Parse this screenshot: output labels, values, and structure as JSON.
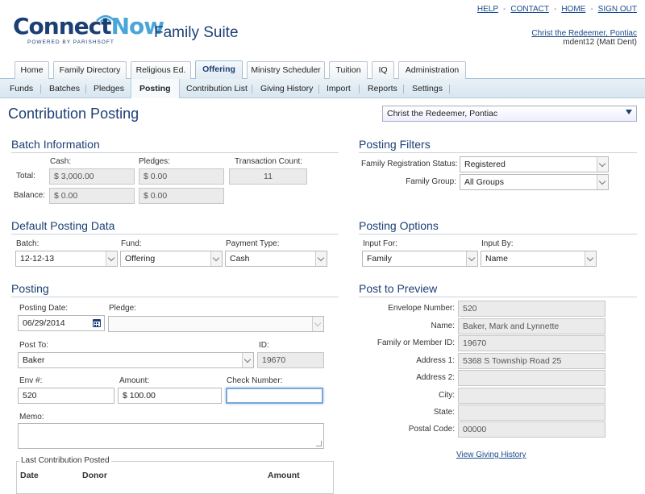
{
  "header": {
    "logo_connect": "Connect",
    "logo_now": "Now",
    "logo_sub": "POWERED BY PARISHSOFT",
    "suite_title": "Family Suite",
    "links": [
      "HELP",
      "CONTACT",
      "HOME",
      "SIGN OUT"
    ],
    "parish_link": "Christ the Redeemer, Pontiac",
    "user": "mdent12 (Matt Dent)"
  },
  "main_tabs": [
    "Home",
    "Family Directory",
    "Religious Ed.",
    "Offering",
    "Ministry Scheduler",
    "Tuition",
    "IQ",
    "Administration"
  ],
  "sub_tabs": [
    "Funds",
    "Batches",
    "Pledges",
    "Posting",
    "Contribution List",
    "Giving History",
    "Import",
    "Reports",
    "Settings"
  ],
  "page": {
    "title": "Contribution Posting",
    "parish_select": "Christ the Redeemer, Pontiac"
  },
  "batch_info": {
    "title": "Batch Information",
    "col_cash": "Cash:",
    "col_pledges": "Pledges:",
    "col_count": "Transaction Count:",
    "row_total": "Total:",
    "row_balance": "Balance:",
    "total_cash": "$ 3,000.00",
    "total_pledges": "$ 0.00",
    "count": "11",
    "balance_cash": "$ 0.00",
    "balance_pledges": "$ 0.00"
  },
  "posting_filters": {
    "title": "Posting Filters",
    "reg_label": "Family Registration Status:",
    "reg_value": "Registered",
    "group_label": "Family Group:",
    "group_value": "All Groups"
  },
  "default_posting": {
    "title": "Default Posting Data",
    "batch_label": "Batch:",
    "batch_value": "12-12-13",
    "fund_label": "Fund:",
    "fund_value": "Offering",
    "payment_label": "Payment Type:",
    "payment_value": "Cash"
  },
  "posting_options": {
    "title": "Posting Options",
    "input_for_label": "Input For:",
    "input_for_value": "Family",
    "input_by_label": "Input By:",
    "input_by_value": "Name"
  },
  "posting": {
    "title": "Posting",
    "date_label": "Posting Date:",
    "date_value": "06/29/2014",
    "pledge_label": "Pledge:",
    "pledge_value": "",
    "post_to_label": "Post To:",
    "post_to_value": "Baker",
    "id_label": "ID:",
    "id_value": "19670",
    "env_label": "Env #:",
    "env_value": "520",
    "amount_label": "Amount:",
    "amount_value": "$ 100.00",
    "check_label": "Check Number:",
    "check_value": "",
    "memo_label": "Memo:",
    "last_legend": "Last Contribution Posted",
    "col_date": "Date",
    "col_donor": "Donor",
    "col_amount": "Amount"
  },
  "preview": {
    "title": "Post to Preview",
    "fields": [
      {
        "label": "Envelope Number:",
        "value": "520"
      },
      {
        "label": "Name:",
        "value": "Baker, Mark and Lynnette"
      },
      {
        "label": "Family or Member ID:",
        "value": "19670"
      },
      {
        "label": "Address 1:",
        "value": "5368 S Township Road 25"
      },
      {
        "label": "Address 2:",
        "value": ""
      },
      {
        "label": "City:",
        "value": ""
      },
      {
        "label": "State:",
        "value": ""
      },
      {
        "label": "Postal Code:",
        "value": "00000"
      }
    ],
    "history_link": "View Giving History"
  },
  "colors": {
    "brand_navy": "#1c3f75",
    "brand_light_blue": "#4aa6d8",
    "tab_bar": "#d8e6f0",
    "focus_border": "#7aa7d6"
  }
}
